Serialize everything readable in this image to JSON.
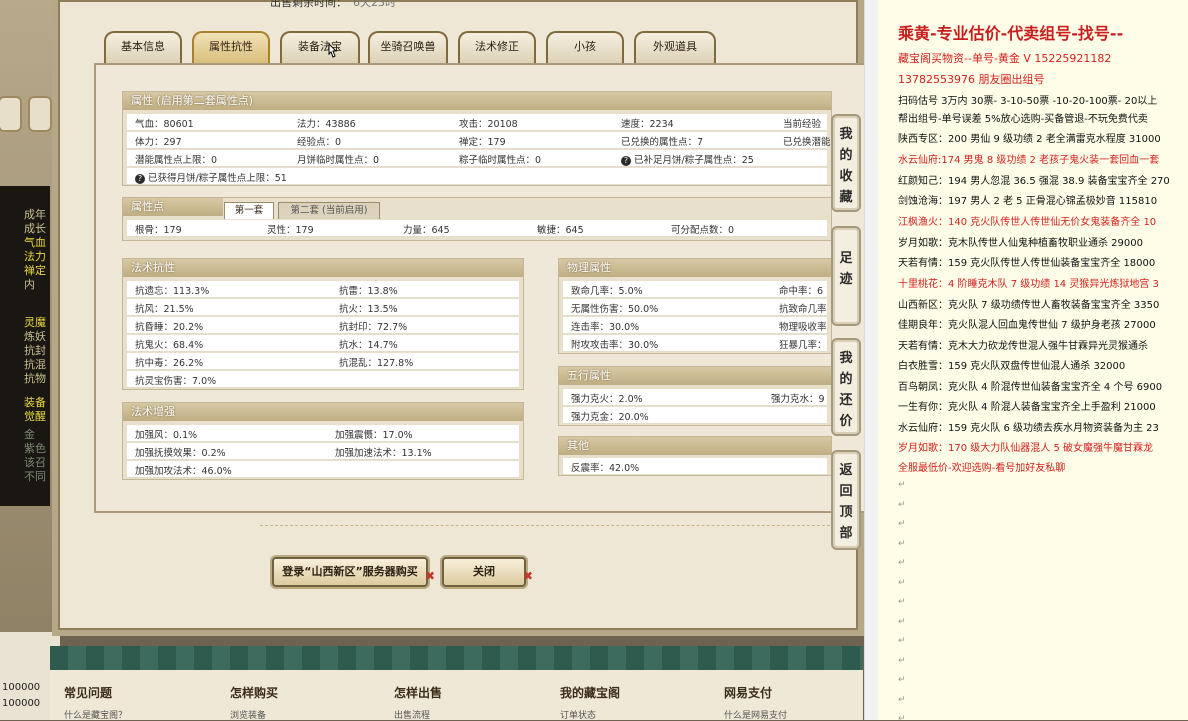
{
  "header": {
    "label": "出售剩余时间：",
    "value": "6天23时"
  },
  "tabs": [
    "基本信息",
    "属性抗性",
    "装备法宝",
    "坐骑召唤兽",
    "法术修正",
    "小孩",
    "外观道具"
  ],
  "active_tab": "属性抗性",
  "attr": {
    "title": "属性 (启用第二套属性点)",
    "rows": [
      [
        "气血：80601",
        "法力：43886",
        "攻击：20108",
        "速度：2234",
        "当前经验"
      ],
      [
        "体力：297",
        "经验点：0",
        "禅定：179",
        "已兑换的属性点：7",
        "已兑换潜能"
      ],
      [
        "潜能属性点上限：0",
        "月饼临时属性点：0",
        "粽子临时属性点：0",
        "已补足月饼/粽子属性点：25",
        ""
      ]
    ],
    "note": "已获得月饼/粽子属性点上限：51"
  },
  "points": {
    "title": "属性点",
    "subtabs": [
      "第一套",
      "第二套 (当前启用)"
    ],
    "row": [
      "根骨：179",
      "灵性：179",
      "力量：645",
      "敏捷：645",
      "可分配点数：0"
    ]
  },
  "resist": {
    "title": "法术抗性",
    "rows": [
      [
        "抗遗忘：113.3%",
        "抗雷：13.8%"
      ],
      [
        "抗风：21.5%",
        "抗火：13.5%"
      ],
      [
        "抗昏睡：20.2%",
        "抗封印：72.7%"
      ],
      [
        "抗鬼火：68.4%",
        "抗水：14.7%"
      ],
      [
        "抗中毒：26.2%",
        "抗混乱：127.8%"
      ],
      [
        "抗灵宝伤害：7.0%",
        ""
      ]
    ]
  },
  "enhance": {
    "title": "法术增强",
    "rows": [
      [
        "加强风：0.1%",
        "加强震慑：17.0%"
      ],
      [
        "加强抚摸效果：0.2%",
        "加强加速法术：13.1%"
      ],
      [
        "加强加攻法术：46.0%",
        ""
      ]
    ]
  },
  "physical": {
    "title": "物理属性",
    "rows": [
      [
        "致命几率：5.0%",
        "命中率：6"
      ],
      [
        "无属性伤害：50.0%",
        "抗致命几率"
      ],
      [
        "连击率：30.0%",
        "物理吸收率"
      ],
      [
        "附攻攻击率：30.0%",
        "狂暴几率："
      ]
    ]
  },
  "five": {
    "title": "五行属性",
    "rows": [
      [
        "强力克火：2.0%",
        "强力克水：9"
      ],
      [
        "强力克金：20.0%",
        ""
      ]
    ]
  },
  "other": {
    "title": "其他",
    "rows": [
      [
        "反震率：42.0%"
      ]
    ]
  },
  "buttons": {
    "buy": "登录“山西新区”服务器购买",
    "close": "关闭"
  },
  "side_buttons": [
    "我的收藏",
    "足迹",
    "我的还价",
    "返回顶部"
  ],
  "footer": {
    "cols": [
      {
        "title": "常见问题",
        "sub": "什么是藏宝阁？"
      },
      {
        "title": "怎样购买",
        "sub": "浏览装备"
      },
      {
        "title": "怎样出售",
        "sub": "出售流程"
      },
      {
        "title": "我的藏宝阁",
        "sub": "订单状态"
      },
      {
        "title": "网易支付",
        "sub": "什么是网易支付"
      }
    ]
  },
  "left": {
    "lines": [
      "成年",
      "成长",
      "气血",
      "法力",
      "禅定",
      "内"
    ],
    "lines2": [
      "灵魔",
      "炼妖",
      "抗封",
      "抗混",
      "抗物"
    ],
    "lines3": [
      "装备",
      "觉醒",
      "金",
      "紫色",
      "该召",
      "不同"
    ],
    "bottom": [
      "100000",
      "100000"
    ]
  },
  "right": {
    "title": "乘黄-专业估价-代卖组号-找号--",
    "lines": [
      {
        "t": "藏宝阁买物资--单号-黄金 V 15225921182  13782553976 朋友圈出组号",
        "red": true
      },
      {
        "t": "扫码估号 3万内 30票- 3-10-50票  -10-20-100票- 20以上",
        "red": false
      },
      {
        "t": "帮出组号-单号误差 5%放心选购-买备管退-不玩免费代卖",
        "red": false
      },
      {
        "t": "陕西专区：200 男仙 9 级功绩 2 老全满雷克水程度 31000",
        "red": false
      },
      {
        "t": "水云仙府:174 男鬼 8 级功绩 2 老孩子鬼火装一套回血一套",
        "red": true
      },
      {
        "t": "红颜知己：194 男人忽混 36.5 强混 38.9 装备宝宝齐全 270",
        "red": false
      },
      {
        "t": "剑蚀沧海：197 男人 2 老 5 正骨混心锦孟极妙音 115810",
        "red": false
      },
      {
        "t": "江枫渔火：140 克火队传世人传世仙无价女鬼装备齐全 10",
        "red": true
      },
      {
        "t": "岁月如歌：克木队传世人仙鬼种植畜牧职业通杀 29000",
        "red": false
      },
      {
        "t": "天若有情：159 克火队传世人传世仙装备宝宝齐全 18000",
        "red": false
      },
      {
        "t": "十里桃花：4 阶睡克木队 7 级功绩 14 灵猴异光炼狱地宫 3",
        "red": true
      },
      {
        "t": "山西新区：克火队 7 级功绩传世人畜牧装备宝宝齐全 3350",
        "red": false
      },
      {
        "t": "佳期良年：克火队混人回血鬼传世仙 7 级护身老孩 27000",
        "red": false
      },
      {
        "t": "天若有情：克木大力砍龙传世混人强牛甘霖异光灵猴通杀",
        "red": false
      },
      {
        "t": "白衣胜雪：159 克火队双盘传世仙混人通杀 32000",
        "red": false
      },
      {
        "t": "百鸟朝凤：克火队 4 阶混传世仙装备宝宝齐全 4 个号 6900",
        "red": false
      },
      {
        "t": "一生有你：克火队 4 阶混人装备宝宝齐全上手盈利 21000",
        "red": false
      },
      {
        "t": "水云仙府：159 克火队 6 级功绩去疾水月物资装备为主 23",
        "red": false
      },
      {
        "t": "岁月如歌：170 级大力队仙器混人 5 破女魔强牛魔甘霖龙",
        "red": true
      },
      {
        "t": "全服最低价-欢迎选购-看号加好友私聊",
        "red": true
      }
    ],
    "returns": [
      "↵",
      "↵",
      "↵",
      "↵",
      "↵",
      "↵",
      "↵",
      "↵",
      "↵",
      "↵",
      "↵",
      "↵",
      "↵"
    ]
  }
}
